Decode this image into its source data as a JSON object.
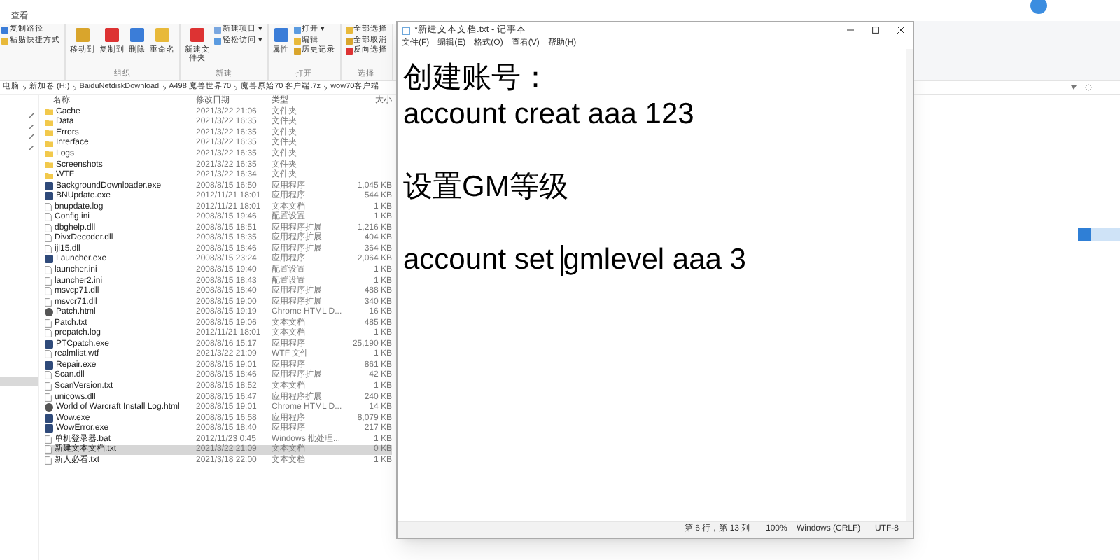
{
  "explorer": {
    "tab": "查看",
    "ribbon": [
      {
        "items": [
          {
            "label": "复制路径",
            "kind": "small"
          },
          {
            "label": "粘贴快捷方式",
            "kind": "small"
          }
        ]
      },
      {
        "label": "组织",
        "items": [
          {
            "label": "移动到",
            "kind": "large"
          },
          {
            "label": "复制到",
            "kind": "large"
          },
          {
            "label": "删除",
            "kind": "large"
          },
          {
            "label": "重命名",
            "kind": "large"
          }
        ]
      },
      {
        "label": "新建",
        "items": [
          {
            "label": "新建文件夹",
            "kind": "large"
          },
          {
            "label": "新建项目 ▾",
            "kind": "small"
          },
          {
            "label": "轻松访问 ▾",
            "kind": "small"
          }
        ]
      },
      {
        "label": "打开",
        "items": [
          {
            "label": "属性",
            "kind": "large"
          },
          {
            "label": "打开 ▾",
            "kind": "small"
          },
          {
            "label": "编辑",
            "kind": "small"
          },
          {
            "label": "历史记录",
            "kind": "small"
          }
        ]
      },
      {
        "label": "选择",
        "items": [
          {
            "label": "全部选择",
            "kind": "small"
          },
          {
            "label": "全部取消",
            "kind": "small"
          },
          {
            "label": "反向选择",
            "kind": "small"
          }
        ]
      }
    ],
    "breadcrumb": [
      "电脑",
      "新加卷 (H:)",
      "BaiduNetdiskDownload",
      "A498 魔兽世界70",
      "魔兽原始70 客户端.7z",
      "wow70客户端"
    ],
    "columns": [
      "名称",
      "修改日期",
      "类型",
      "大小"
    ],
    "files": [
      {
        "name": "Cache",
        "date": "2021/3/22 21:06",
        "type": "文件夹",
        "kind": "folder",
        "selected": false
      },
      {
        "name": "Data",
        "date": "2021/3/22 16:35",
        "type": "文件夹",
        "kind": "folder",
        "selected": false
      },
      {
        "name": "Errors",
        "date": "2021/3/22 16:35",
        "type": "文件夹",
        "kind": "folder",
        "selected": false
      },
      {
        "name": "Interface",
        "date": "2021/3/22 16:35",
        "type": "文件夹",
        "kind": "folder",
        "selected": false
      },
      {
        "name": "Logs",
        "date": "2021/3/22 16:35",
        "type": "文件夹",
        "kind": "folder",
        "selected": false
      },
      {
        "name": "Screenshots",
        "date": "2021/3/22 16:35",
        "type": "文件夹",
        "kind": "folder",
        "selected": false
      },
      {
        "name": "WTF",
        "date": "2021/3/22 16:34",
        "type": "文件夹",
        "kind": "folder",
        "selected": false
      },
      {
        "name": "BackgroundDownloader.exe",
        "date": "2008/8/15 16:50",
        "type": "应用程序",
        "size": "1,045 KB",
        "kind": "exe",
        "selected": false
      },
      {
        "name": "BNUpdate.exe",
        "date": "2012/11/21 18:01",
        "type": "应用程序",
        "size": "544 KB",
        "kind": "exe",
        "selected": false
      },
      {
        "name": "bnupdate.log",
        "date": "2012/11/21 18:01",
        "type": "文本文档",
        "size": "1 KB",
        "kind": "file",
        "selected": false
      },
      {
        "name": "Config.ini",
        "date": "2008/8/15 19:46",
        "type": "配置设置",
        "size": "1 KB",
        "kind": "file",
        "selected": false
      },
      {
        "name": "dbghelp.dll",
        "date": "2008/8/15 18:51",
        "type": "应用程序扩展",
        "size": "1,216 KB",
        "kind": "file",
        "selected": false
      },
      {
        "name": "DivxDecoder.dll",
        "date": "2008/8/15 18:35",
        "type": "应用程序扩展",
        "size": "404 KB",
        "kind": "file",
        "selected": false
      },
      {
        "name": "ijl15.dll",
        "date": "2008/8/15 18:46",
        "type": "应用程序扩展",
        "size": "364 KB",
        "kind": "file",
        "selected": false
      },
      {
        "name": "Launcher.exe",
        "date": "2008/8/15 23:24",
        "type": "应用程序",
        "size": "2,064 KB",
        "kind": "exe",
        "selected": false
      },
      {
        "name": "launcher.ini",
        "date": "2008/8/15 19:40",
        "type": "配置设置",
        "size": "1 KB",
        "kind": "file",
        "selected": false
      },
      {
        "name": "launcher2.ini",
        "date": "2008/8/15 18:43",
        "type": "配置设置",
        "size": "1 KB",
        "kind": "file",
        "selected": false
      },
      {
        "name": "msvcp71.dll",
        "date": "2008/8/15 18:40",
        "type": "应用程序扩展",
        "size": "488 KB",
        "kind": "file",
        "selected": false
      },
      {
        "name": "msvcr71.dll",
        "date": "2008/8/15 19:00",
        "type": "应用程序扩展",
        "size": "340 KB",
        "kind": "file",
        "selected": false
      },
      {
        "name": "Patch.html",
        "date": "2008/8/15 19:19",
        "type": "Chrome HTML D...",
        "size": "16 KB",
        "kind": "html",
        "selected": false
      },
      {
        "name": "Patch.txt",
        "date": "2008/8/15 19:06",
        "type": "文本文档",
        "size": "485 KB",
        "kind": "file",
        "selected": false
      },
      {
        "name": "prepatch.log",
        "date": "2012/11/21 18:01",
        "type": "文本文档",
        "size": "1 KB",
        "kind": "file",
        "selected": false
      },
      {
        "name": "PTCpatch.exe",
        "date": "2008/8/16 15:17",
        "type": "应用程序",
        "size": "25,190 KB",
        "kind": "exe",
        "selected": false
      },
      {
        "name": "realmlist.wtf",
        "date": "2021/3/22 21:09",
        "type": "WTF 文件",
        "size": "1 KB",
        "kind": "file",
        "selected": false
      },
      {
        "name": "Repair.exe",
        "date": "2008/8/15 19:01",
        "type": "应用程序",
        "size": "861 KB",
        "kind": "exe",
        "selected": false
      },
      {
        "name": "Scan.dll",
        "date": "2008/8/15 18:46",
        "type": "应用程序扩展",
        "size": "42 KB",
        "kind": "file",
        "selected": false
      },
      {
        "name": "ScanVersion.txt",
        "date": "2008/8/15 18:52",
        "type": "文本文档",
        "size": "1 KB",
        "kind": "file",
        "selected": false
      },
      {
        "name": "unicows.dll",
        "date": "2008/8/15 16:47",
        "type": "应用程序扩展",
        "size": "240 KB",
        "kind": "file",
        "selected": false
      },
      {
        "name": "World of Warcraft Install Log.html",
        "date": "2008/8/15 19:01",
        "type": "Chrome HTML D...",
        "size": "14 KB",
        "kind": "html",
        "selected": false
      },
      {
        "name": "Wow.exe",
        "date": "2008/8/15 16:58",
        "type": "应用程序",
        "size": "8,079 KB",
        "kind": "exe",
        "selected": false
      },
      {
        "name": "WowError.exe",
        "date": "2008/8/15 18:40",
        "type": "应用程序",
        "size": "217 KB",
        "kind": "exe",
        "selected": false
      },
      {
        "name": "单机登录器.bat",
        "date": "2012/11/23 0:45",
        "type": "Windows 批处理...",
        "size": "1 KB",
        "kind": "file",
        "selected": false
      },
      {
        "name": "新建文本文档.txt",
        "date": "2021/3/22 21:09",
        "type": "文本文档",
        "size": "0 KB",
        "kind": "file",
        "selected": true
      },
      {
        "name": "新人必看.txt",
        "date": "2021/3/18 22:00",
        "type": "文本文档",
        "size": "1 KB",
        "kind": "file",
        "selected": false
      }
    ]
  },
  "notepad": {
    "title": "*新建文本文档.txt - 记事本",
    "menu": [
      "文件(F)",
      "编辑(E)",
      "格式(O)",
      "查看(V)",
      "帮助(H)"
    ],
    "lines": [
      {
        "kind": "text",
        "text": "创建账号："
      },
      {
        "kind": "text",
        "text": "account creat aaa 123"
      },
      {
        "kind": "blank"
      },
      {
        "kind": "text",
        "text": "设置GM等级"
      },
      {
        "kind": "blank"
      },
      {
        "kind": "cursor",
        "before": "account set ",
        "after": "gmlevel aaa 3"
      }
    ],
    "status": [
      "第 6 行，第 13 列",
      "100%",
      "Windows (CRLF)",
      "UTF-8"
    ]
  }
}
